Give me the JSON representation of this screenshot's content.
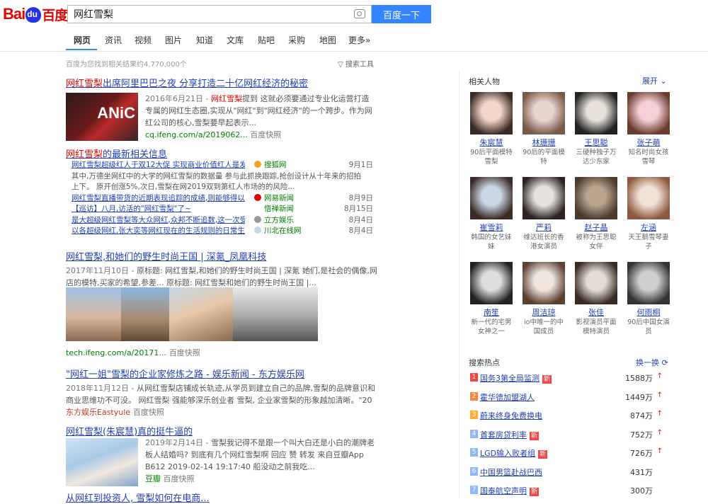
{
  "logo": {
    "text1": "Bai",
    "text2": "百度"
  },
  "search": {
    "query": "网红雪梨",
    "button": "百度一下"
  },
  "tabs": [
    "网页",
    "资讯",
    "视频",
    "图片",
    "知道",
    "文库",
    "贴吧",
    "采购",
    "地图",
    "更多»"
  ],
  "result_count": "百度为您找到相关结果约4,770,000个",
  "search_tools": "搜索工具",
  "results": {
    "r1": {
      "title_em": "网红雪梨",
      "title_rest": "出席阿里巴巴之夜 分享打造二十亿网红经济的秘密",
      "thumb_text": "ANiC",
      "date": "2016年6月21日 - ",
      "desc_em": "网红雪梨",
      "desc1": "提到 这就必须要通过专业化运营打造专属的网红生态圈,实现从\"网红\"到\"网红经济\"的一个跨步。作为网红公司的核心,雪梨要早起表示...",
      "url": "cq.ifeng.com/a/2019062...",
      "snapshot": "百度快照"
    },
    "r2": {
      "title_em": "网红雪梨",
      "title_rest": "的最新相关信息",
      "news": [
        {
          "title": "网红雪梨超级红人于双12大促 实现商业价值红人是发...",
          "src": "搜狐网",
          "date": "9月1日",
          "icon": "#f5a623"
        },
        {
          "title": "其中,万德坐网红中的大学的网红雪梨的数据量 参与此抓换跟踪,抢创设计从十年来的招拍",
          "src": "",
          "date": "",
          "icon": ""
        },
        {
          "title": "上下。 原开创涨5%,次日,雪梨在网2019双到第红人市场的的风险...",
          "src": "",
          "date": "",
          "icon": ""
        },
        {
          "title": "网红雪梨直播带货的近期表现追踪的成绩,则能够得以持续王...",
          "src": "网易新闻",
          "date": "8月9日",
          "icon": "#e10601"
        },
        {
          "title": "【巡访】八月,访活的\"网红雪梨\"了~",
          "src": "悟禅新闻",
          "date": "8月15日",
          "icon": ""
        },
        {
          "title": "是大超级网红雪梨等大众网红,众邦不断追数,这一次受...",
          "src": "立方娱乐",
          "date": "8月4日",
          "icon": "#999999"
        },
        {
          "title": "以各超级网红,张大奕等网红现在的生活规则的日常生活...",
          "src": "川北在线网",
          "date": "8月4日",
          "icon": "#c9d6e8"
        }
      ]
    },
    "r3": {
      "title": "网红雪梨,和她们的野生时尚王国 | 深氪_凤凰科技",
      "date": "2017年11月10日 - ",
      "desc": "原标题: 网红雪梨,和她们的野生时尚王国 | 深氪 她们,是社会的偶像,网店的模特,买家的希望,参差... 原标题: 网红雪梨和她们的野生时尚王国 |...",
      "url": "tech.ifeng.com/a/20171...",
      "snapshot": "百度快照"
    },
    "r4": {
      "title": "\"网红一姐\"雪梨的企业家修炼之路 - 娱乐新闻 - 东方娱乐网",
      "date": "2018年11月12日 - ",
      "desc": "从网红雪梨店铺成长轨迹,从学员到建立自己的品牌,雪梨的品牌意识和商业思维功不可没。 网红雪梨 强能够深乐创业者 雪梨, 企业家雪梨的形象越加清晰。\"20",
      "url": "东方娱乐Eastyule",
      "snapshot": "百度快照"
    },
    "r5": {
      "title": "网红雪梨(朱宸慧)真的挺牛逼的",
      "date": "2019年2月14日 - ",
      "desc": "雪梨我记得不是跟一个叫大白还是小白的潮牌老板人结婚吗? 到底有几个网红雪梨啊 回应 赞 转发 来自豆瓣App B612 2019-02-14 19:17:40 船没动之前我吃...",
      "url": "豆瓣",
      "snapshot": "百度快照"
    },
    "r6": {
      "title": "从网红到投资人, 雪梨如何在电商..."
    }
  },
  "right": {
    "related_title": "相关人物",
    "toggle": "展开",
    "people": [
      {
        "name": "朱宸慧",
        "desc": "90后平面模特雪梨"
      },
      {
        "name": "林珊珊",
        "desc": "90后的平面模特"
      },
      {
        "name": "王思聪",
        "desc": "三硬种独子万达少东家"
      },
      {
        "name": "张子萌",
        "desc": "知名时尚女孩雪琴"
      },
      {
        "name": "崔雪莉",
        "desc": "韩国的女艺妹妹"
      },
      {
        "name": "严莉",
        "desc": "维达班长的香港女演员"
      },
      {
        "name": "赵子晶",
        "desc": "被称为王思聪女伴"
      },
      {
        "name": "左涵",
        "desc": "天王鹅雪琴妻子"
      },
      {
        "name": "南笙",
        "desc": "新一代的宅男女神之一"
      },
      {
        "name": "周洁琼",
        "desc": "io中唯一的中国成员"
      },
      {
        "name": "张佳",
        "desc": "影视演员平面模特演员"
      },
      {
        "name": "何雨桐",
        "desc": "90后中国女演员"
      }
    ],
    "hot_title": "搜索热点",
    "hot_refresh": "换一换",
    "hot": [
      {
        "rank": "1",
        "text": "国务3第全局监测",
        "badge": "新",
        "count": "1588万",
        "color": "#f54545"
      },
      {
        "rank": "2",
        "text": "霍华德加盟湖人",
        "badge": "",
        "count": "1449万",
        "color": "#ff8547"
      },
      {
        "rank": "3",
        "text": "蔚来终身免费换电",
        "badge": "",
        "count": "874万",
        "color": "#ffac38"
      },
      {
        "rank": "4",
        "text": "首套房贷利率",
        "badge": "新",
        "count": "752万",
        "color": "#8eb9f5"
      },
      {
        "rank": "5",
        "text": "LGD输入败者组",
        "badge": "新",
        "count": "726万",
        "color": "#8eb9f5"
      },
      {
        "rank": "6",
        "text": "中国男篮赴战巴西",
        "badge": "",
        "count": "431万",
        "color": "#8eb9f5"
      },
      {
        "rank": "7",
        "text": "国泰航空声明",
        "badge": "新",
        "count": "300万",
        "color": "#8eb9f5"
      }
    ]
  }
}
